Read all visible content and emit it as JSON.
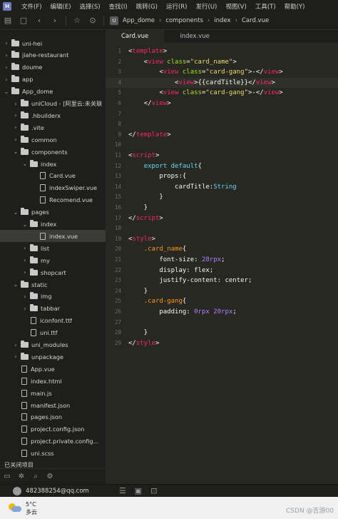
{
  "menu": {
    "logo": "H",
    "items": [
      "文件(F)",
      "编辑(E)",
      "选择(S)",
      "查找(I)",
      "跳转(G)",
      "运行(R)",
      "发行(U)",
      "视图(V)",
      "工具(T)",
      "帮助(Y)"
    ]
  },
  "breadcrumb": {
    "mark": "U",
    "parts": [
      "App_dome",
      "components",
      "index",
      "Card.vue"
    ]
  },
  "sidebar": {
    "items": [
      {
        "label": "uni-hei",
        "type": "folder",
        "chev": "›"
      },
      {
        "label": "jiahe-restaurant",
        "type": "folder",
        "chev": "›"
      },
      {
        "label": "doume",
        "type": "folder",
        "chev": "›"
      },
      {
        "label": "app",
        "type": "folder",
        "chev": "›"
      },
      {
        "label": "App_dome",
        "type": "folder",
        "chev": "⌄"
      },
      {
        "label": "uniCloud - [阿里云:未关联",
        "type": "folder",
        "chev": "›"
      },
      {
        "label": ".hbuilderx",
        "type": "folder",
        "chev": "›"
      },
      {
        "label": ".vite",
        "type": "folder",
        "chev": "›"
      },
      {
        "label": "common",
        "type": "folder",
        "chev": "›"
      },
      {
        "label": "components",
        "type": "folder",
        "chev": "⌄"
      },
      {
        "label": "index",
        "type": "folder",
        "chev": "⌄"
      },
      {
        "label": "Card.vue",
        "type": "file",
        "chev": ""
      },
      {
        "label": "indexSwiper.vue",
        "type": "file",
        "chev": ""
      },
      {
        "label": "Recomend.vue",
        "type": "file",
        "chev": ""
      },
      {
        "label": "pages",
        "type": "folder",
        "chev": "⌄"
      },
      {
        "label": "index",
        "type": "folder",
        "chev": "⌄"
      },
      {
        "label": "index.vue",
        "type": "file",
        "chev": ""
      },
      {
        "label": "list",
        "type": "folder",
        "chev": "›"
      },
      {
        "label": "my",
        "type": "folder",
        "chev": "›"
      },
      {
        "label": "shopcart",
        "type": "folder",
        "chev": "›"
      },
      {
        "label": "static",
        "type": "folder",
        "chev": "⌄"
      },
      {
        "label": "img",
        "type": "folder",
        "chev": "›"
      },
      {
        "label": "tabbar",
        "type": "folder",
        "chev": "›"
      },
      {
        "label": "iconfont.ttf",
        "type": "file",
        "chev": ""
      },
      {
        "label": "uni.ttf",
        "type": "file",
        "chev": ""
      },
      {
        "label": "uni_modules",
        "type": "folder",
        "chev": "›"
      },
      {
        "label": "unpackage",
        "type": "folder",
        "chev": "›"
      },
      {
        "label": "App.vue",
        "type": "file",
        "chev": ""
      },
      {
        "label": "index.html",
        "type": "file",
        "chev": ""
      },
      {
        "label": "main.js",
        "type": "file",
        "chev": ""
      },
      {
        "label": "manifest.json",
        "type": "file",
        "chev": ""
      },
      {
        "label": "pages.json",
        "type": "file",
        "chev": ""
      },
      {
        "label": "project.config.json",
        "type": "file",
        "chev": ""
      },
      {
        "label": "project.private.config...",
        "type": "file",
        "chev": ""
      },
      {
        "label": "uni.scss",
        "type": "file",
        "chev": ""
      }
    ],
    "closed_label": "已关闭项目"
  },
  "tabs": [
    {
      "label": "Card.vue",
      "active": true
    },
    {
      "label": "index.vue",
      "active": false
    }
  ],
  "code": [
    [
      [
        "c-plain",
        "<"
      ],
      [
        "c-tag",
        "template"
      ],
      [
        "c-plain",
        ">"
      ]
    ],
    [
      [
        "c-plain",
        "    <"
      ],
      [
        "c-tag",
        "view"
      ],
      [
        "c-attr",
        " class"
      ],
      [
        "c-plain",
        "="
      ],
      [
        "c-str",
        "\"card_name\""
      ],
      [
        "c-plain",
        ">"
      ]
    ],
    [
      [
        "c-plain",
        "        <"
      ],
      [
        "c-tag",
        "view"
      ],
      [
        "c-attr",
        " class"
      ],
      [
        "c-plain",
        "="
      ],
      [
        "c-str",
        "\"card-gang\""
      ],
      [
        "c-plain",
        ">-</"
      ],
      [
        "c-tag",
        "view"
      ],
      [
        "c-plain",
        ">"
      ]
    ],
    [
      [
        "c-plain",
        "            <"
      ],
      [
        "c-tag",
        "view"
      ],
      [
        "c-plain",
        ">{{cardTitle}}</"
      ],
      [
        "c-tag",
        "view"
      ],
      [
        "c-plain",
        ">"
      ]
    ],
    [
      [
        "c-plain",
        "        <"
      ],
      [
        "c-tag",
        "view"
      ],
      [
        "c-attr",
        " class"
      ],
      [
        "c-plain",
        "="
      ],
      [
        "c-str",
        "\"card-gang\""
      ],
      [
        "c-plain",
        ">-</"
      ],
      [
        "c-tag",
        "view"
      ],
      [
        "c-plain",
        ">"
      ]
    ],
    [
      [
        "c-plain",
        "    </"
      ],
      [
        "c-tag",
        "view"
      ],
      [
        "c-plain",
        ">"
      ]
    ],
    [
      [
        "c-plain",
        ""
      ]
    ],
    [
      [
        "c-plain",
        ""
      ]
    ],
    [
      [
        "c-plain",
        "</"
      ],
      [
        "c-tag",
        "template"
      ],
      [
        "c-plain",
        ">"
      ]
    ],
    [
      [
        "c-plain",
        ""
      ]
    ],
    [
      [
        "c-plain",
        "<"
      ],
      [
        "c-tag",
        "script"
      ],
      [
        "c-plain",
        ">"
      ]
    ],
    [
      [
        "c-plain",
        "    "
      ],
      [
        "c-kw",
        "export default"
      ],
      [
        "c-plain",
        "{"
      ]
    ],
    [
      [
        "c-plain",
        "        props:{"
      ]
    ],
    [
      [
        "c-plain",
        "            cardTitle:"
      ],
      [
        "c-kw",
        "String"
      ]
    ],
    [
      [
        "c-plain",
        "        }"
      ]
    ],
    [
      [
        "c-plain",
        "    }"
      ]
    ],
    [
      [
        "c-plain",
        "</"
      ],
      [
        "c-tag",
        "script"
      ],
      [
        "c-plain",
        ">"
      ]
    ],
    [
      [
        "c-plain",
        ""
      ]
    ],
    [
      [
        "c-plain",
        "<"
      ],
      [
        "c-tag",
        "style"
      ],
      [
        "c-plain",
        ">"
      ]
    ],
    [
      [
        "c-plain",
        "    "
      ],
      [
        "c-sel",
        ".card_name"
      ],
      [
        "c-plain",
        "{"
      ]
    ],
    [
      [
        "c-plain",
        "        font-size: "
      ],
      [
        "c-num",
        "28rpx"
      ],
      [
        "c-plain",
        ";"
      ]
    ],
    [
      [
        "c-plain",
        "        display: flex;"
      ]
    ],
    [
      [
        "c-plain",
        "        justify-content: center;"
      ]
    ],
    [
      [
        "c-plain",
        "    }"
      ]
    ],
    [
      [
        "c-plain",
        "    "
      ],
      [
        "c-sel",
        ".card-gang"
      ],
      [
        "c-plain",
        "{"
      ]
    ],
    [
      [
        "c-plain",
        "        padding: "
      ],
      [
        "c-num",
        "0rpx 20rpx"
      ],
      [
        "c-plain",
        ";"
      ]
    ],
    [
      [
        "c-plain",
        ""
      ]
    ],
    [
      [
        "c-plain",
        "    }"
      ]
    ],
    [
      [
        "c-plain",
        "</"
      ],
      [
        "c-tag",
        "style"
      ],
      [
        "c-plain",
        ">"
      ]
    ]
  ],
  "status": {
    "user": "482388254@qq.com"
  },
  "taskbar": {
    "temp": "5°C",
    "condition": "多云",
    "watermark": "CSDN @吉游00"
  }
}
